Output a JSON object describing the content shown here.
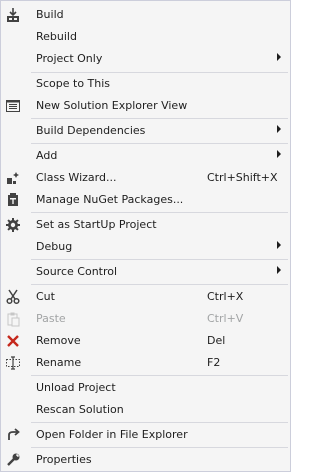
{
  "menu": {
    "items": [
      {
        "label": "Build",
        "shortcut": "",
        "icon": "build-icon",
        "submenu": false
      },
      {
        "label": "Rebuild",
        "shortcut": "",
        "icon": "",
        "submenu": false
      },
      {
        "label": "Project Only",
        "shortcut": "",
        "icon": "",
        "submenu": true
      },
      {
        "label": "Scope to This",
        "shortcut": "",
        "icon": "",
        "submenu": false
      },
      {
        "label": "New Solution Explorer View",
        "shortcut": "",
        "icon": "new-solution-explorer-view-icon",
        "submenu": false
      },
      {
        "label": "Build Dependencies",
        "shortcut": "",
        "icon": "",
        "submenu": true
      },
      {
        "label": "Add",
        "shortcut": "",
        "icon": "",
        "submenu": true
      },
      {
        "label": "Class Wizard...",
        "shortcut": "Ctrl+Shift+X",
        "icon": "class-wizard-icon",
        "submenu": false
      },
      {
        "label": "Manage NuGet Packages...",
        "shortcut": "",
        "icon": "nuget-package-icon",
        "submenu": false
      },
      {
        "label": "Set as StartUp Project",
        "shortcut": "",
        "icon": "gear-icon",
        "submenu": false
      },
      {
        "label": "Debug",
        "shortcut": "",
        "icon": "",
        "submenu": true
      },
      {
        "label": "Source Control",
        "shortcut": "",
        "icon": "",
        "submenu": true
      },
      {
        "label": "Cut",
        "shortcut": "Ctrl+X",
        "icon": "scissors-icon",
        "submenu": false
      },
      {
        "label": "Paste",
        "shortcut": "Ctrl+V",
        "icon": "paste-icon",
        "submenu": false,
        "disabled": true
      },
      {
        "label": "Remove",
        "shortcut": "Del",
        "icon": "remove-x-icon",
        "submenu": false
      },
      {
        "label": "Rename",
        "shortcut": "F2",
        "icon": "rename-icon",
        "submenu": false
      },
      {
        "label": "Unload Project",
        "shortcut": "",
        "icon": "",
        "submenu": false
      },
      {
        "label": "Rescan Solution",
        "shortcut": "",
        "icon": "",
        "submenu": false
      },
      {
        "label": "Open Folder in File Explorer",
        "shortcut": "",
        "icon": "open-folder-arrow-icon",
        "submenu": false
      },
      {
        "label": "Properties",
        "shortcut": "",
        "icon": "wrench-icon",
        "submenu": false
      }
    ]
  },
  "colors": {
    "background": "#f5f5f5",
    "border": "#cccedb",
    "separator": "#d7d8de",
    "text": "#1e1e1e",
    "disabled_text": "#a2a4a5",
    "remove_red": "#c5281c"
  }
}
